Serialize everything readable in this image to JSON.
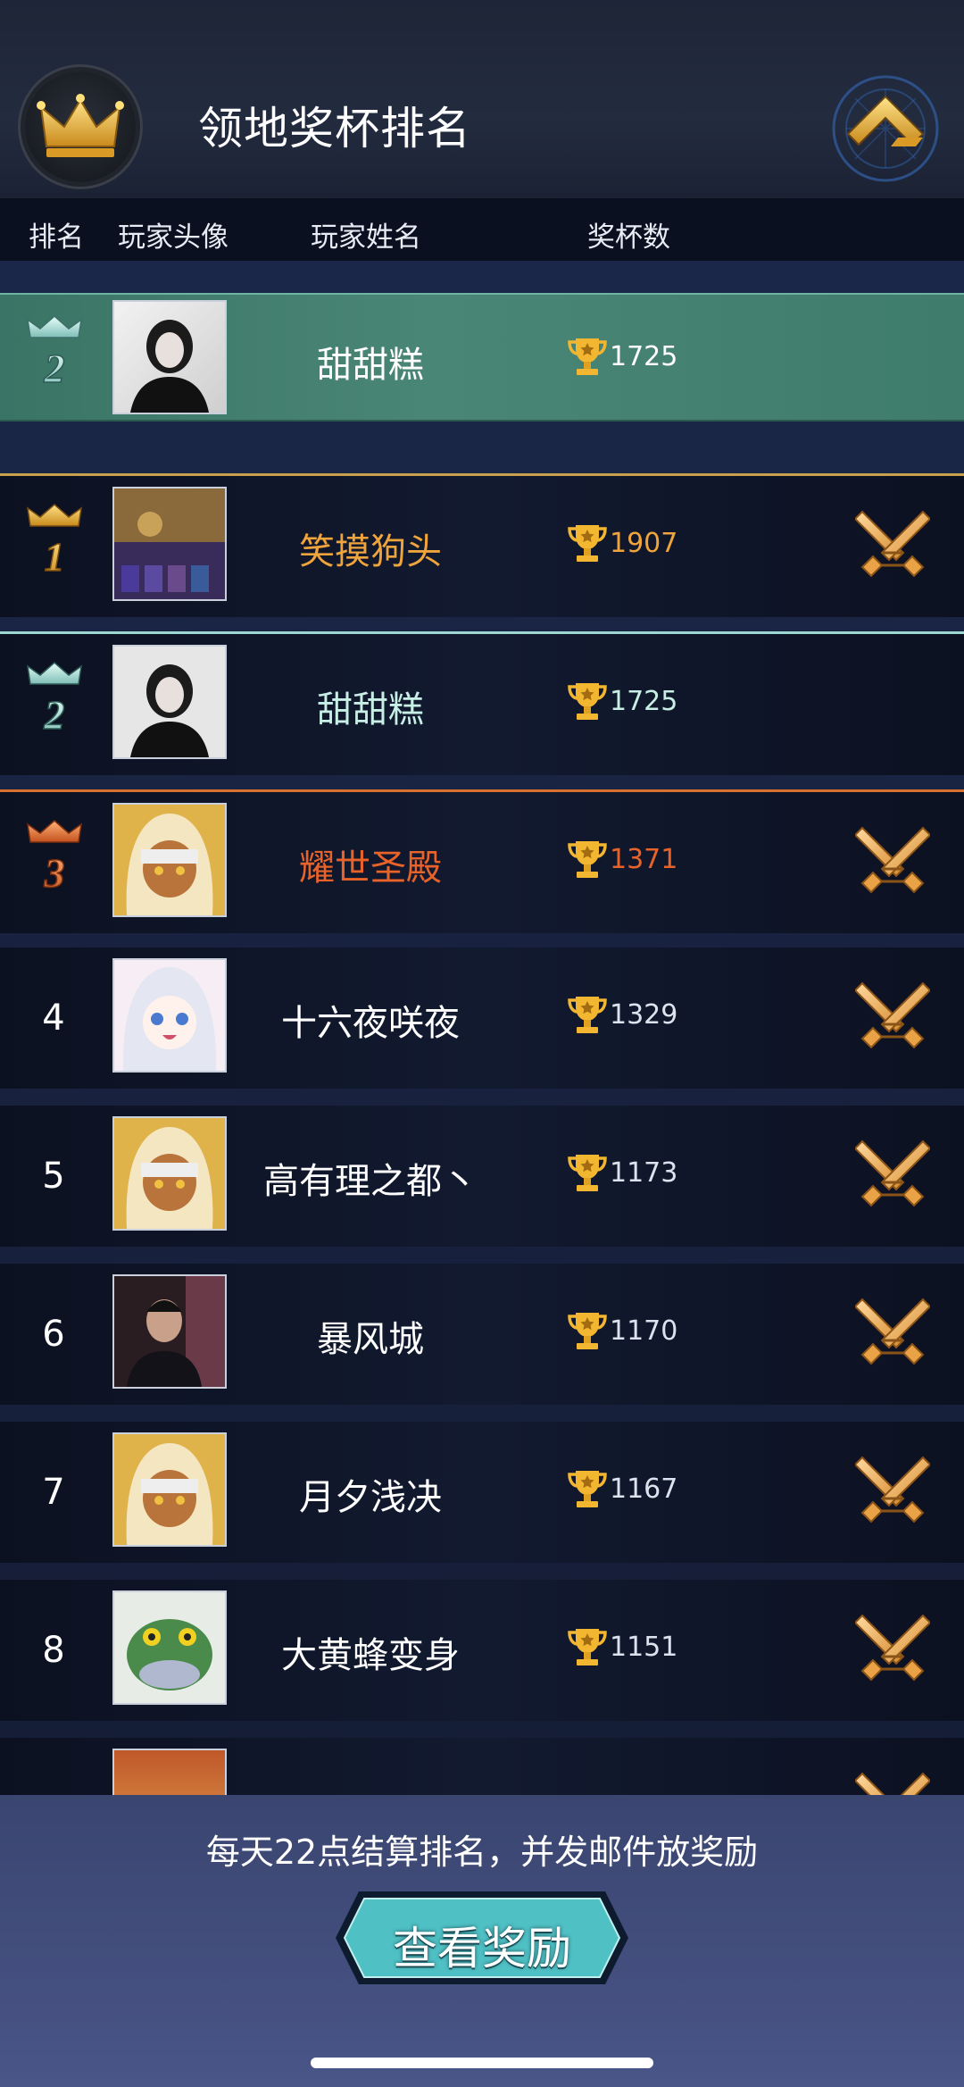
{
  "header": {
    "title": "领地奖杯排名"
  },
  "columns": {
    "rank": "排名",
    "avatar": "玩家头像",
    "name": "玩家姓名",
    "trophies": "奖杯数"
  },
  "self_entry": {
    "rank": "2",
    "name": "甜甜糕",
    "trophies": "1725"
  },
  "rows": [
    {
      "rank": "1",
      "name": "笑摸狗头",
      "trophies": "1907",
      "name_color": "#f0a43c",
      "count_color": "#f0a43c",
      "avatar": "game-scene"
    },
    {
      "rank": "2",
      "name": "甜甜糕",
      "trophies": "1725",
      "name_color": "#c8efe6",
      "count_color": "#c8efe6",
      "avatar": "girl-photo"
    },
    {
      "rank": "3",
      "name": "耀世圣殿",
      "trophies": "1371",
      "name_color": "#e8632a",
      "count_color": "#e8632a",
      "avatar": "anime-hooded"
    },
    {
      "rank": "4",
      "name": "十六夜咲夜",
      "trophies": "1329",
      "name_color": "#ffffff",
      "count_color": "#dce3ee",
      "avatar": "anime-white-hair"
    },
    {
      "rank": "5",
      "name": "高有理之都丶",
      "trophies": "1173",
      "name_color": "#ffffff",
      "count_color": "#dce3ee",
      "avatar": "anime-hooded"
    },
    {
      "rank": "6",
      "name": "暴风城",
      "trophies": "1170",
      "name_color": "#ffffff",
      "count_color": "#dce3ee",
      "avatar": "man-photo"
    },
    {
      "rank": "7",
      "name": "月夕浅决",
      "trophies": "1167",
      "name_color": "#ffffff",
      "count_color": "#dce3ee",
      "avatar": "anime-hooded"
    },
    {
      "rank": "8",
      "name": "大黄蜂变身",
      "trophies": "1151",
      "name_color": "#ffffff",
      "count_color": "#dce3ee",
      "avatar": "frog-monster"
    }
  ],
  "footer": {
    "notice": "每天22点结算排名，并发邮件放奖励",
    "button": "查看奖励"
  },
  "colors": {
    "gold": "#f0a43c",
    "silver": "#9ed6d2",
    "bronze": "#e8632a",
    "self_highlight": "#4a8676"
  },
  "icons": {
    "header_left": "crown-icon",
    "header_right": "back-arrow-icon",
    "trophy": "trophy-icon",
    "battle": "crossed-swords-icon"
  }
}
